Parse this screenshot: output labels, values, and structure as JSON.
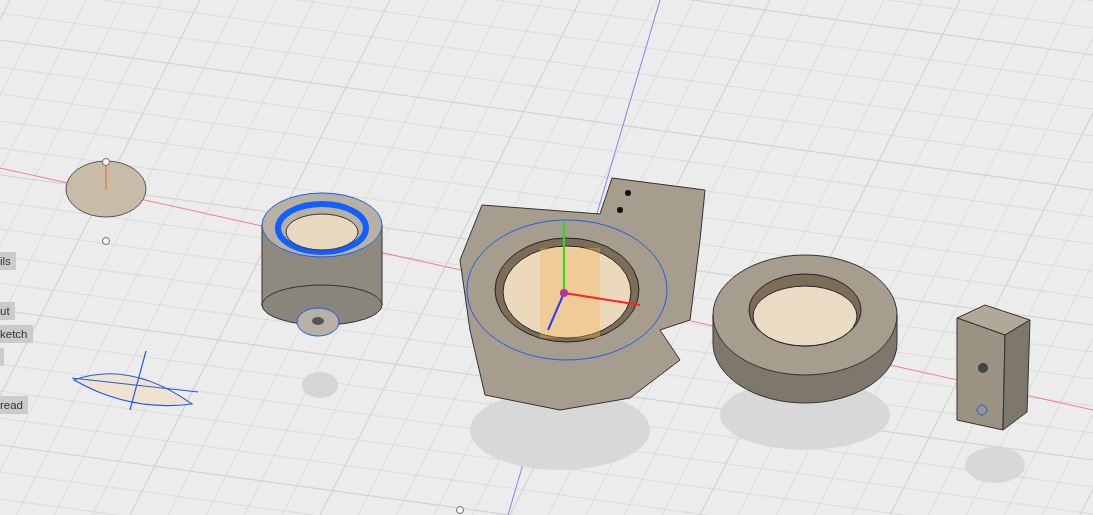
{
  "viewport": {
    "side_labels": [
      {
        "text": "ils"
      },
      {
        "text": "ut"
      },
      {
        "text": "ketch"
      },
      {
        "text": "read"
      }
    ]
  }
}
